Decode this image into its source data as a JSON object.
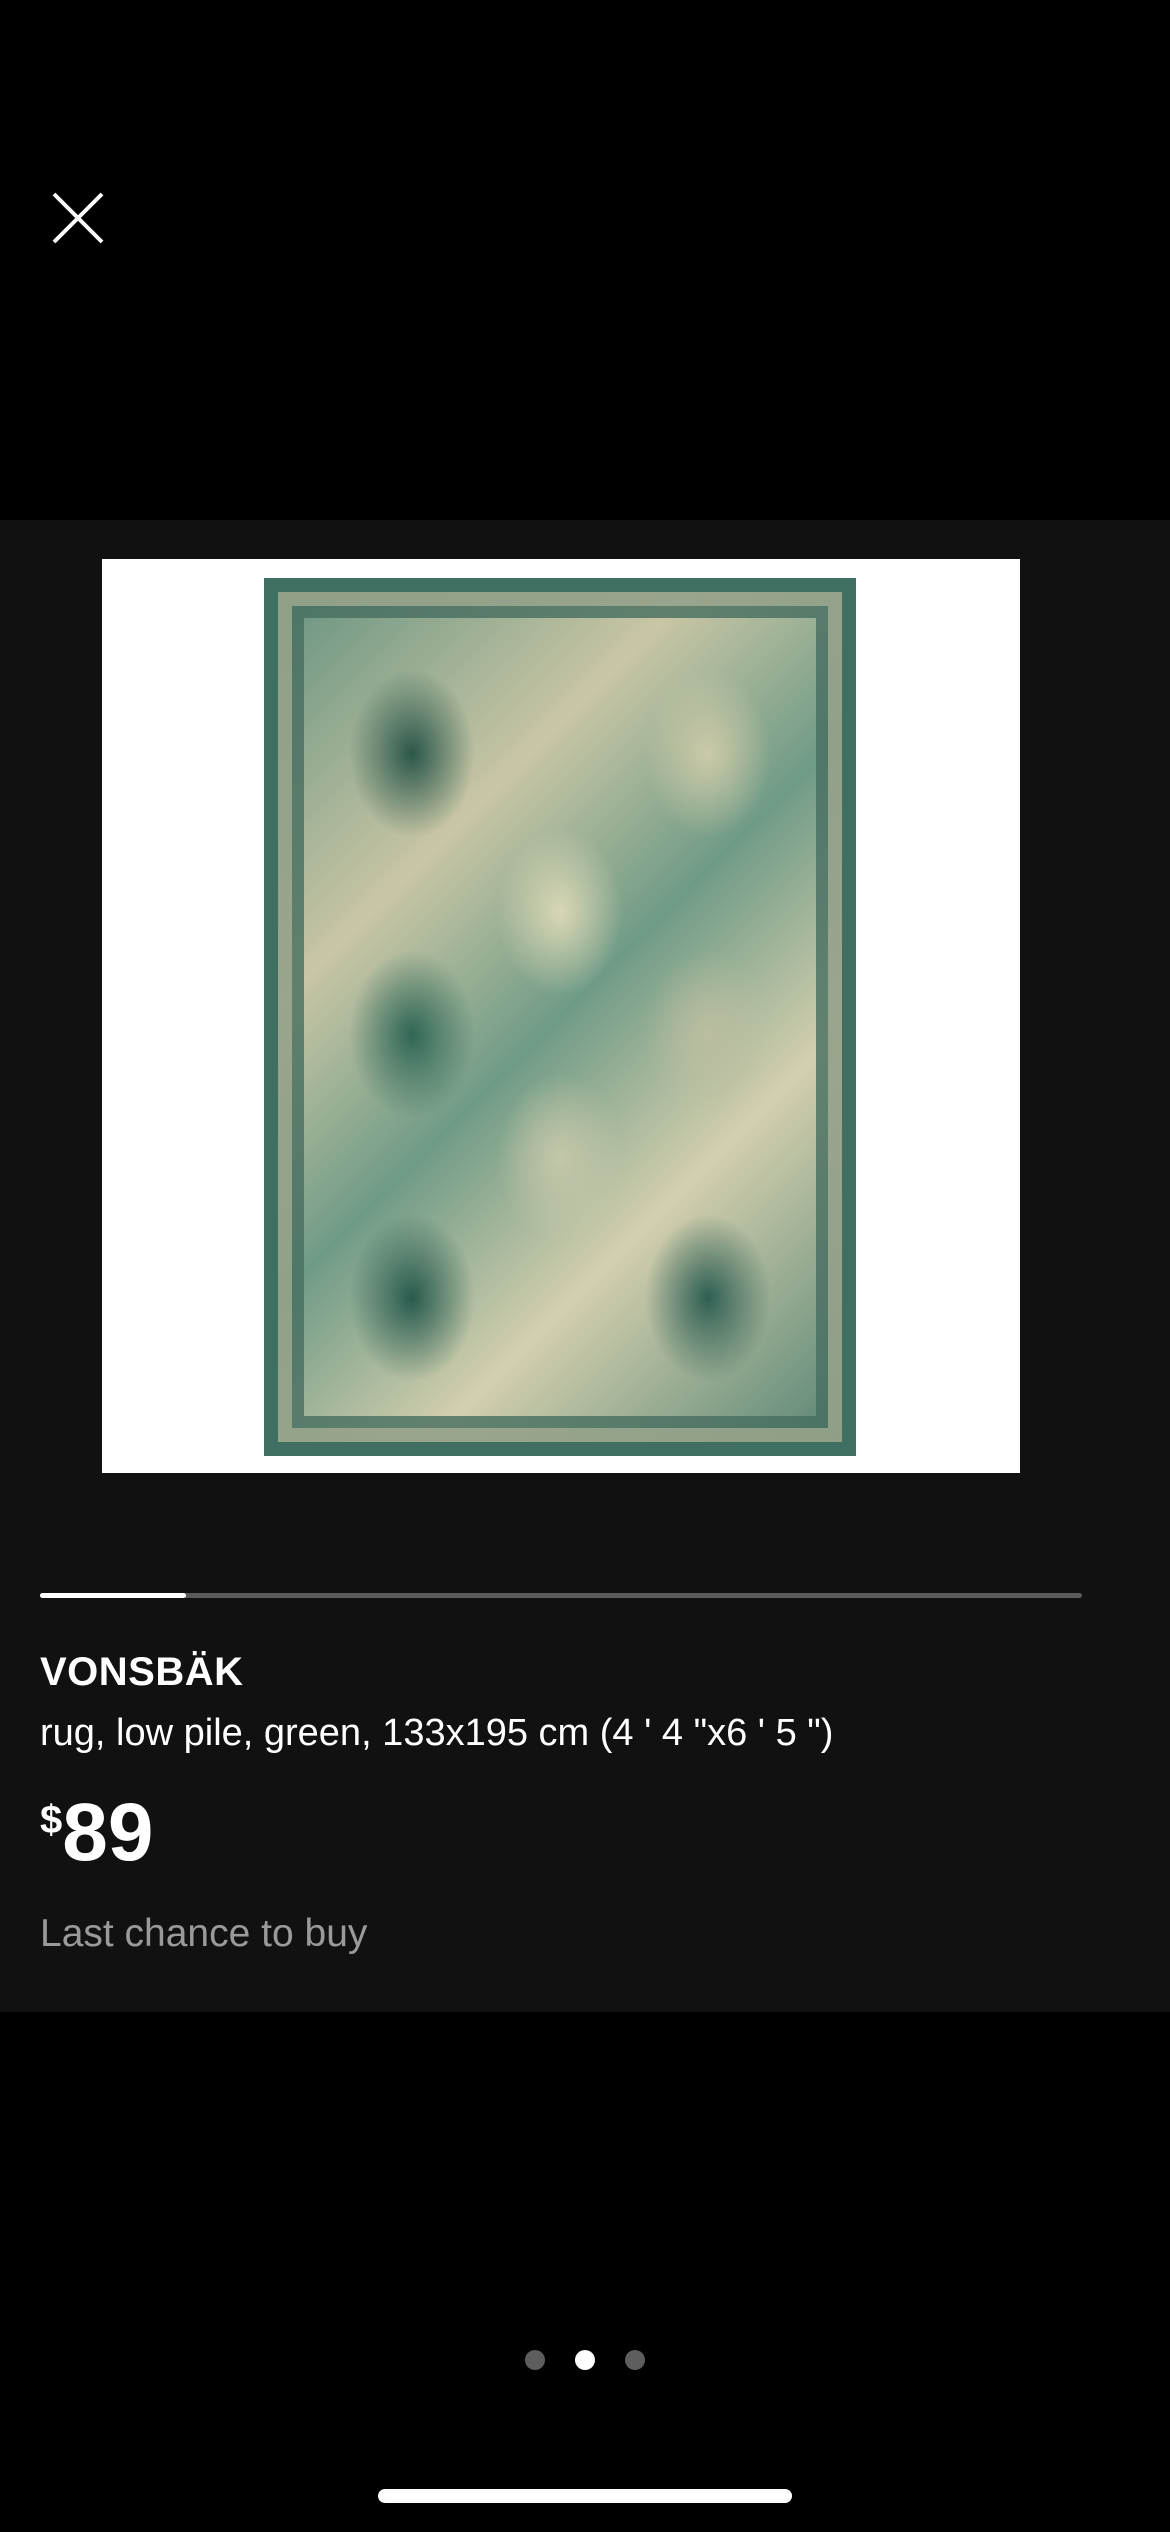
{
  "header": {
    "close_icon": "close-icon"
  },
  "product": {
    "name": "VONSBÄK",
    "description": "rug, low pile, green, 133x195 cm (4 ' 4 \"x6 ' 5 \")",
    "price_currency": "$",
    "price_amount": "89",
    "status": "Last chance to buy",
    "image_alt": "VONSBÄK rug, green"
  },
  "gallery": {
    "progress": 0.14,
    "pages": 3,
    "active_page": 2
  },
  "colors": {
    "background": "#000000",
    "card": "#111111",
    "status_text": "#9a9a9a"
  }
}
